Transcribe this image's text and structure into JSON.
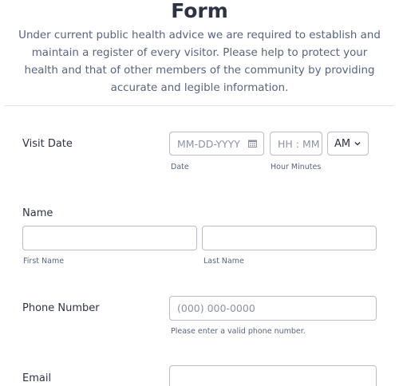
{
  "header": {
    "title": "Form",
    "description": "Under current public health advice we are required to establish and maintain a register of every visitor. Please help to protect your health and that of other members of the community by providing accurate and legible information."
  },
  "visit_date": {
    "label": "Visit Date",
    "date_placeholder": "MM-DD-YYYY",
    "date_sublabel": "Date",
    "time_placeholder": "HH : MM",
    "time_sublabel": "Hour Minutes",
    "ampm_value": "AM"
  },
  "name": {
    "label": "Name",
    "first_sublabel": "First Name",
    "last_sublabel": "Last Name"
  },
  "phone": {
    "label": "Phone Number",
    "placeholder": "(000) 000-0000",
    "sublabel": "Please enter a valid phone number."
  },
  "email": {
    "label": "Email"
  },
  "icons": {
    "calendar": "calendar-icon",
    "chevron": "chevron-down-icon"
  }
}
